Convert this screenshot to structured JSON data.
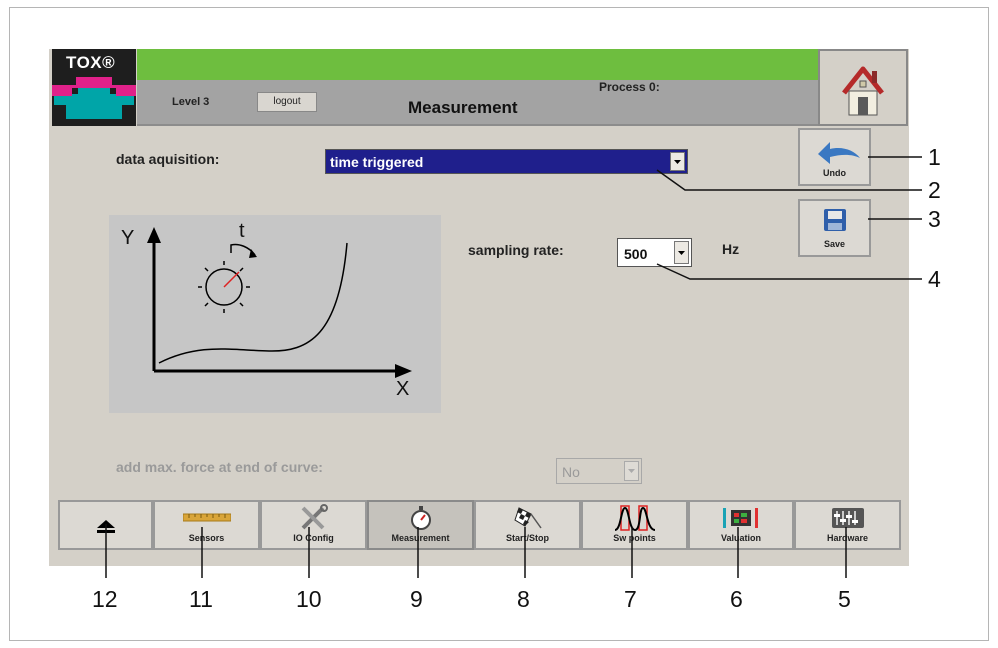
{
  "header": {
    "logo_text": "TOX®",
    "level": "Level 3",
    "logout_label": "logout",
    "title": "Measurement",
    "process": "Process 0:"
  },
  "side_buttons": {
    "undo_label": "Undo",
    "save_label": "Save"
  },
  "form": {
    "data_acquisition_label": "data aquisition:",
    "data_acquisition_value": "time triggered",
    "sampling_rate_label": "sampling rate:",
    "sampling_rate_value": "500",
    "sampling_rate_unit": "Hz",
    "max_force_label": "add max. force at end of curve:",
    "max_force_value": "No"
  },
  "graph": {
    "y_label": "Y",
    "x_label": "X",
    "t_label": "t"
  },
  "nav": [
    {
      "label": "",
      "icon": "eject-icon"
    },
    {
      "label": "Sensors",
      "icon": "ruler-icon"
    },
    {
      "label": "IO Config",
      "icon": "tools-icon"
    },
    {
      "label": "Measurement",
      "icon": "stopwatch-icon",
      "active": true
    },
    {
      "label": "Start/Stop",
      "icon": "checkered-flag-icon"
    },
    {
      "label": "Sw points",
      "icon": "switch-points-icon"
    },
    {
      "label": "Valuation",
      "icon": "valuation-icon"
    },
    {
      "label": "Hardware",
      "icon": "hardware-icon"
    }
  ],
  "callouts": [
    "1",
    "2",
    "3",
    "4",
    "5",
    "6",
    "7",
    "8",
    "9",
    "10",
    "11",
    "12"
  ],
  "colors": {
    "green_bar": "#6ebe3f",
    "header_gray": "#a3a3a3",
    "panel": "#d4d0c8",
    "select_highlight": "#1f1f8c",
    "logo_magenta": "#e0218a",
    "logo_teal": "#00a5a8"
  }
}
